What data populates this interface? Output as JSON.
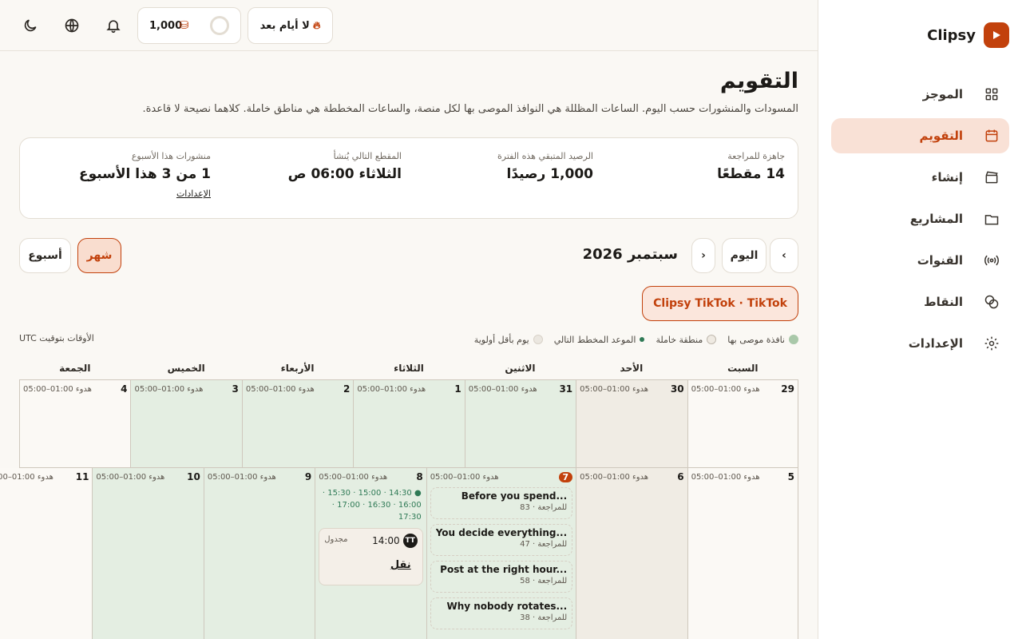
{
  "topbar": {
    "streak_label": "لا أيام بعد",
    "credits_value": "1,000"
  },
  "page": {
    "title": "التقويم",
    "description": "المسودات والمنشورات حسب اليوم. الساعات المظللة هي النوافذ الموصى بها لكل منصة، والساعات المخططة هي مناطق خاملة. كلاهما نصيحة لا قاعدة."
  },
  "stats": [
    {
      "label": "جاهزة للمراجعة",
      "value": "14 مقطعًا"
    },
    {
      "label": "الرصيد المتبقي هذه الفترة",
      "value": "1,000 رصيدًا"
    },
    {
      "label": "المقطع التالي يُنشأ",
      "value": "الثلاثاء 06:00 ص"
    },
    {
      "label": "منشورات هذا الأسبوع",
      "value": "1 من 3 هذا الأسبوع",
      "link": "الإعدادات"
    }
  ],
  "controls": {
    "prev": "‹",
    "today": "اليوم",
    "next": "›",
    "month_label": "سبتمبر 2026",
    "view_month": "شهر",
    "view_week": "أسبوع",
    "channel": "Clipsy TikTok · TikTok"
  },
  "legend": {
    "items": [
      "نافذة موصى بها",
      "منطقة خاملة",
      "الموعد المخطط التالي",
      "يوم بأقل أولوية"
    ],
    "colors": [
      "#a9c8a9",
      "#efeae2",
      "#2f7a56",
      "#ebe7e0"
    ],
    "timezone": "الأوقات بتوقيت UTC"
  },
  "weekdays": [
    "السبت",
    "الأحد",
    "الاثنين",
    "الثلاثاء",
    "الأربعاء",
    "الخميس",
    "الجمعة"
  ],
  "quiet_text": "هدوء 01:00–05:00",
  "weeks": [
    [
      {
        "day": "29",
        "bg": "plain"
      },
      {
        "day": "30",
        "bg": "rest"
      },
      {
        "day": "31",
        "bg": "rec"
      },
      {
        "day": "1",
        "bg": "rec"
      },
      {
        "day": "2",
        "bg": "rec"
      },
      {
        "day": "3",
        "bg": "rec"
      },
      {
        "day": "4",
        "bg": "plain"
      }
    ],
    [
      {
        "day": "5",
        "bg": "plain"
      },
      {
        "day": "6",
        "bg": "rest"
      },
      {
        "day": "7",
        "bg": "rec",
        "today": true,
        "drafts": [
          {
            "title": "Before you spend...",
            "meta": "للمراجعة · 83"
          },
          {
            "title": "You decide everything...",
            "meta": "للمراجعة · 47"
          },
          {
            "title": "Post at the right hour...",
            "meta": "للمراجعة · 58"
          },
          {
            "title": "Why nobody rotates...",
            "meta": "للمراجعة · 38"
          }
        ]
      },
      {
        "day": "8",
        "bg": "rec",
        "slots": "● 14:30 · 15:00 · 15:30 · 16:00 · 16:30 · 17:00 · 17:30",
        "post": {
          "time": "14:00",
          "badge": "TT",
          "status": "مجدول",
          "title": "نقل"
        }
      },
      {
        "day": "9",
        "bg": "rec"
      },
      {
        "day": "10",
        "bg": "rec"
      },
      {
        "day": "11",
        "bg": "plain"
      }
    ]
  ],
  "sidebar": {
    "brand": "Clipsy",
    "items": [
      {
        "label": "الموجز",
        "icon": "grid-icon"
      },
      {
        "label": "التقويم",
        "icon": "calendar-icon"
      },
      {
        "label": "إنشاء",
        "icon": "clapper-icon"
      },
      {
        "label": "المشاريع",
        "icon": "folder-icon"
      },
      {
        "label": "القنوات",
        "icon": "broadcast-icon"
      },
      {
        "label": "النقاط",
        "icon": "coins-icon"
      },
      {
        "label": "الإعدادات",
        "icon": "gear-icon"
      }
    ]
  }
}
